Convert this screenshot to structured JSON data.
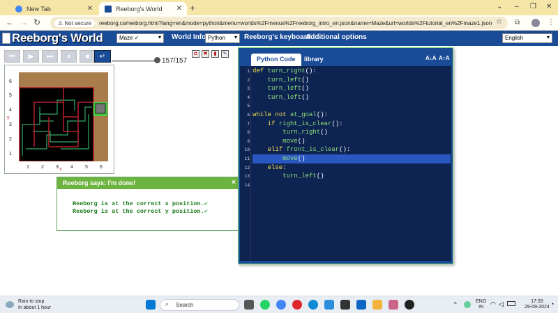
{
  "browser": {
    "tabs": [
      {
        "label": "New Tab"
      },
      {
        "label": "Reeborg's World"
      }
    ],
    "new_tab_glyph": "+",
    "window_controls": [
      "⌄",
      "–",
      "❐",
      "✕"
    ],
    "not_secure_label": "Not secure",
    "url": "reeborg.ca/reeborg.html?lang=en&mode=python&menu=worlds%2Fmenus%2Freeborg_intro_en.json&name=Maze&url=worlds%2Ftutorial_en%2Fmaze1.json"
  },
  "header": {
    "title": "Reeborg's World",
    "world_select": "Maze ✓",
    "world_info": "World Info",
    "language_select": "Python",
    "keyboard": "Reeborg's keyboard",
    "options": "Additional options",
    "ui_language": "English"
  },
  "controls": {
    "step_count": "157",
    "step_total": "157"
  },
  "world": {
    "y_axis_label": "y",
    "x_axis_label": "x",
    "y_ticks": [
      "6",
      "5",
      "4",
      "3",
      "2",
      "1"
    ],
    "x_ticks": [
      "1",
      "2",
      "3",
      "4",
      "5",
      "6"
    ]
  },
  "dialog": {
    "title": "Reeborg says: I'm done!",
    "close": "×",
    "lines": [
      "Reeborg is at the correct x position.",
      "Reeborg is at the correct y position."
    ],
    "check_glyph": "✔"
  },
  "editor": {
    "tabs": [
      "Python Code",
      "library"
    ],
    "font_buttons": [
      "A↓A",
      "A↑A"
    ],
    "line_numbers": [
      "1",
      "2",
      "3",
      "4",
      "5",
      "6",
      "7",
      "8",
      "9",
      "10",
      "11",
      "12",
      "13",
      "14"
    ],
    "code": [
      "def turn_right():",
      "    turn_left()",
      "    turn_left()",
      "    turn_left()",
      "",
      "while not at_goal():",
      "    if right_is_clear():",
      "        turn_right()",
      "        move()",
      "    elif front_is_clear():",
      "        move()",
      "    else:",
      "        turn_left()",
      ""
    ],
    "highlight_line": 11
  },
  "taskbar": {
    "weather_title": "Rain to stop",
    "weather_sub": "In about 1 hour",
    "search": "Search",
    "lang_top": "ENG",
    "lang_bottom": "IN",
    "time": "17:33",
    "date": "29-09-2024"
  },
  "colors": {
    "header_blue": "#1a4b97",
    "editor_bg": "#0d2352",
    "dialog_green": "#6db33f",
    "keyword": "#f5e04f",
    "function": "#8fe07b"
  }
}
